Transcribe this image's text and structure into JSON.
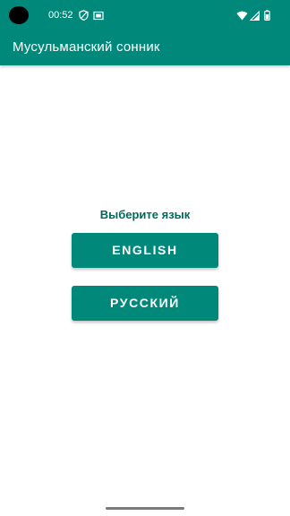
{
  "status_bar": {
    "time": "00:52",
    "left_icons": [
      "shield-icon",
      "screenshot-icon"
    ],
    "right_icons": [
      "wifi-icon",
      "signal-icon",
      "battery-icon"
    ],
    "color": "#00897b"
  },
  "app_bar": {
    "title": "Мусульманский сонник",
    "color": "#00897b"
  },
  "main": {
    "prompt": "Выберите язык",
    "prompt_color": "#00695c",
    "buttons": [
      {
        "label": "ENGLISH"
      },
      {
        "label": "РУССКИЙ"
      }
    ],
    "button_color": "#00897b"
  }
}
